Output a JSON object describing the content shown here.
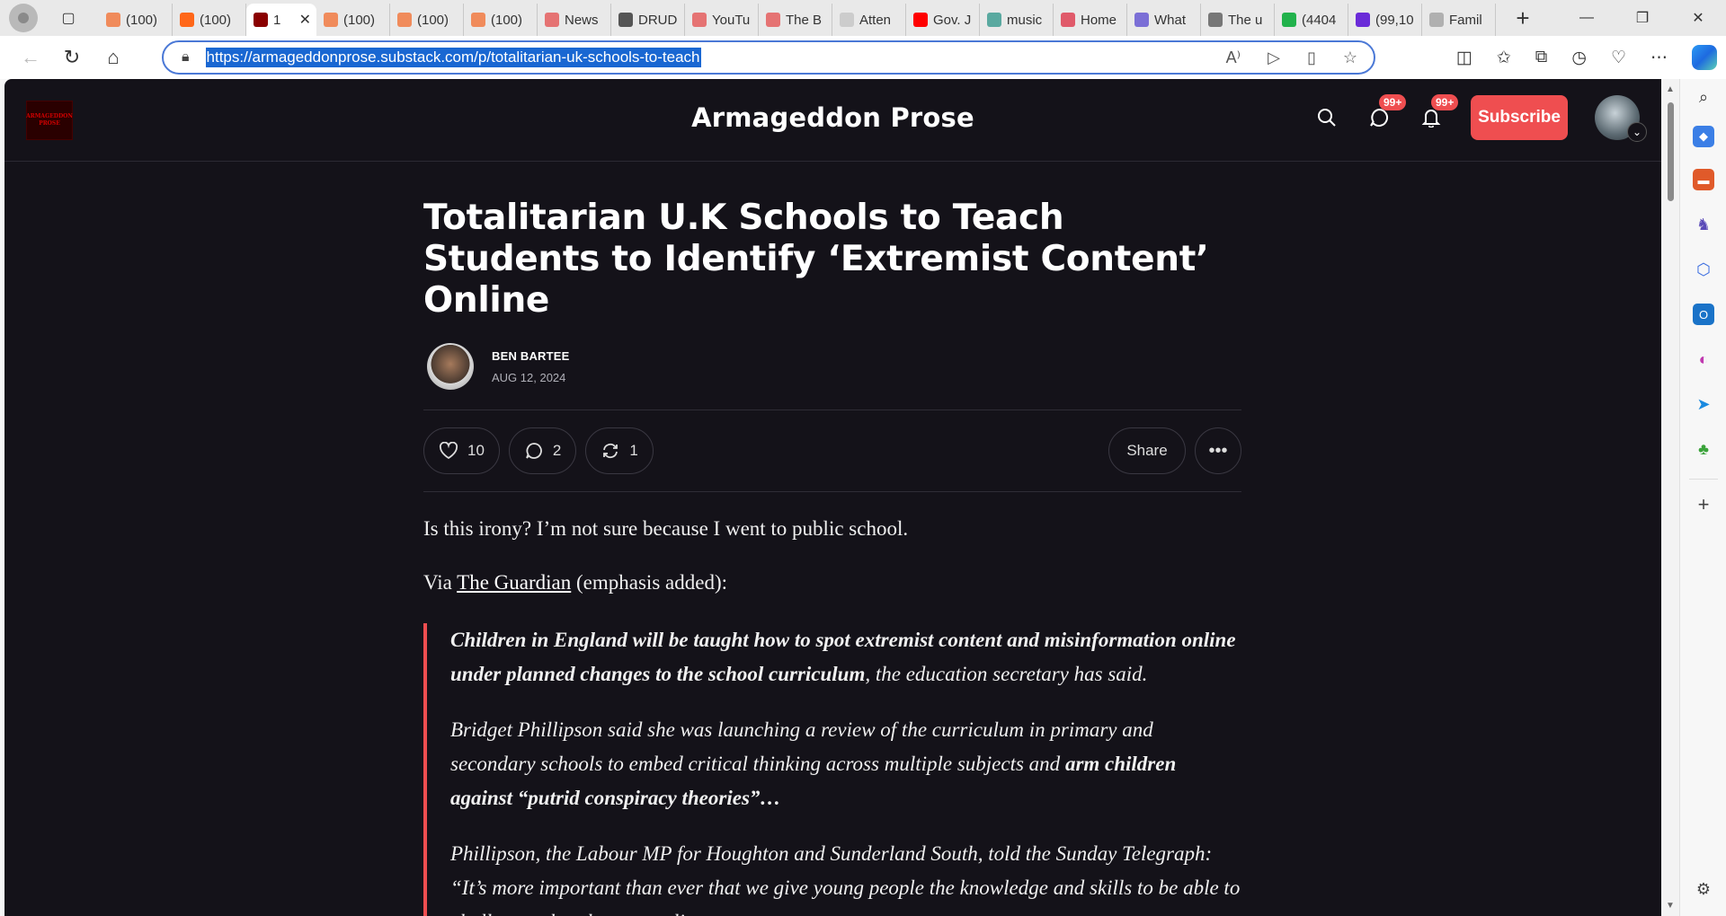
{
  "browser": {
    "tabs": [
      {
        "label": "(100)",
        "color": "#f08b5b"
      },
      {
        "label": "(100)",
        "color": "#ff6719"
      },
      {
        "label": "1",
        "color": "#8a0000",
        "active": true
      },
      {
        "label": "(100)",
        "color": "#f08b5b"
      },
      {
        "label": "(100)",
        "color": "#f08b5b"
      },
      {
        "label": "(100)",
        "color": "#f08b5b"
      },
      {
        "label": "News",
        "color": "#e57373"
      },
      {
        "label": "DRUD",
        "color": "#555555"
      },
      {
        "label": "YouTu",
        "color": "#e57373"
      },
      {
        "label": "The B",
        "color": "#e57373"
      },
      {
        "label": "Atten",
        "color": "#cccccc"
      },
      {
        "label": "Gov. J",
        "color": "#ff0000"
      },
      {
        "label": "music",
        "color": "#5aa9a0"
      },
      {
        "label": "Home",
        "color": "#e05a6a"
      },
      {
        "label": "What",
        "color": "#7b6fd6"
      },
      {
        "label": "The u",
        "color": "#777777"
      },
      {
        "label": "(4404",
        "color": "#22b24c"
      },
      {
        "label": "(99,10",
        "color": "#6a2bd8"
      },
      {
        "label": "Famil",
        "color": "#b0b0b0"
      }
    ],
    "url": "https://armageddonprose.substack.com/p/totalitarian-uk-schools-to-teach",
    "window_controls": [
      "—",
      "❐",
      "✕"
    ]
  },
  "site": {
    "name": "Armageddon Prose",
    "logo_text": "ARMAGEDDON PROSE",
    "chat_badge": "99+",
    "notif_badge": "99+",
    "subscribe_label": "Subscribe"
  },
  "article": {
    "title": "Totalitarian U.K Schools to Teach Students to Identify ‘Extremist Content’ Online",
    "author": "BEN BARTEE",
    "date": "AUG 12, 2024",
    "likes": "10",
    "comments": "2",
    "restacks": "1",
    "share_label": "Share",
    "intro": "Is this irony? I’m not sure because I went to public school.",
    "via_prefix": "Via ",
    "via_link": "The Guardian",
    "via_suffix": " (emphasis added):",
    "quote1_bold": "Children in England will be taught how to spot extremist content and misinformation online under planned changes to the school curriculum",
    "quote1_rest": ", the education secretary has said.",
    "quote2_plain": "Bridget Phillipson said she was launching a review of the curriculum in primary and secondary schools to embed critical thinking across multiple subjects and ",
    "quote2_bold": "arm children against “putrid conspiracy theories”…",
    "quote3": "Phillipson, the Labour MP for Houghton and Sunderland South, told the Sunday Telegraph: “It’s more important than ever that we give young people the knowledge and skills to be able to challenge what they see online."
  }
}
